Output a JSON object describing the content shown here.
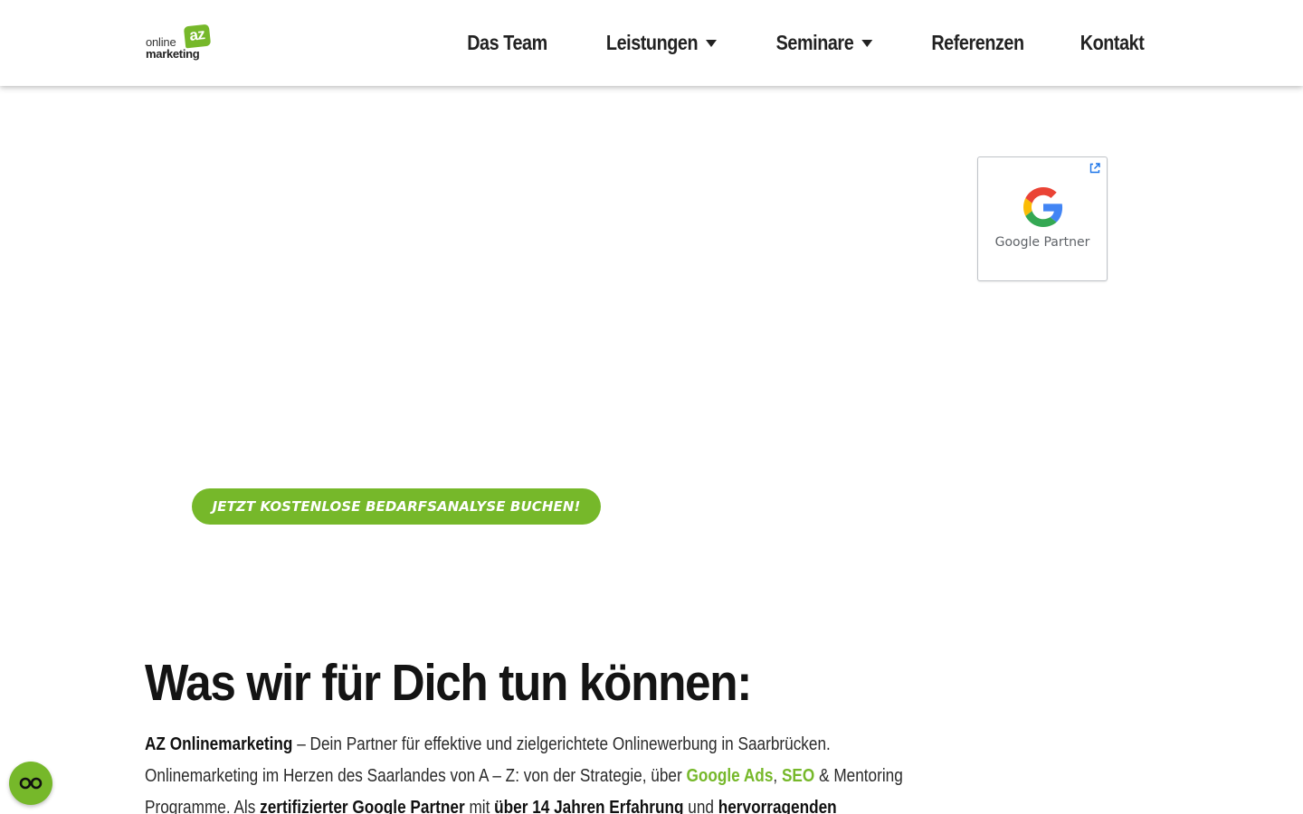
{
  "header": {
    "logo": {
      "small": "online",
      "bold": "marketing",
      "badge": "az"
    },
    "nav": [
      {
        "label": "Das Team",
        "dropdown": false
      },
      {
        "label": "Leistungen",
        "dropdown": true
      },
      {
        "label": "Seminare",
        "dropdown": true
      },
      {
        "label": "Referenzen",
        "dropdown": false
      },
      {
        "label": "Kontakt",
        "dropdown": false
      }
    ]
  },
  "badge": {
    "label": "Google Partner",
    "icons": [
      "google-g-icon",
      "external-link-icon"
    ]
  },
  "cta": {
    "label": "JETZT KOSTENLOSE BEDARFSANALYSE BUCHEN!"
  },
  "content": {
    "headline": "Was wir für Dich tun können:",
    "line1": {
      "strong": "AZ Onlinemarketing",
      "rest": " – Dein Partner für effektive und zielgerichtete Onlinewerbung in Saarbrücken."
    },
    "line2": {
      "start": "Onlinemarketing im Herzen des Saarlandes von A – Z: von der Strategie, über ",
      "link1": "Google Ads",
      "sep": ", ",
      "link2": "SEO",
      "end": " & Mentoring"
    },
    "line3": {
      "a": "Programme. Als ",
      "b": "zertifizierter Google Partner",
      "c": " mit ",
      "d": "über 14 Jahren Erfahrung",
      "e": " und ",
      "f": "hervorragenden"
    }
  },
  "a11y": {
    "icon": "accessibility-glasses-icon"
  },
  "colors": {
    "accent": "#76b82a",
    "text": "#141414",
    "nav": "#222222"
  }
}
